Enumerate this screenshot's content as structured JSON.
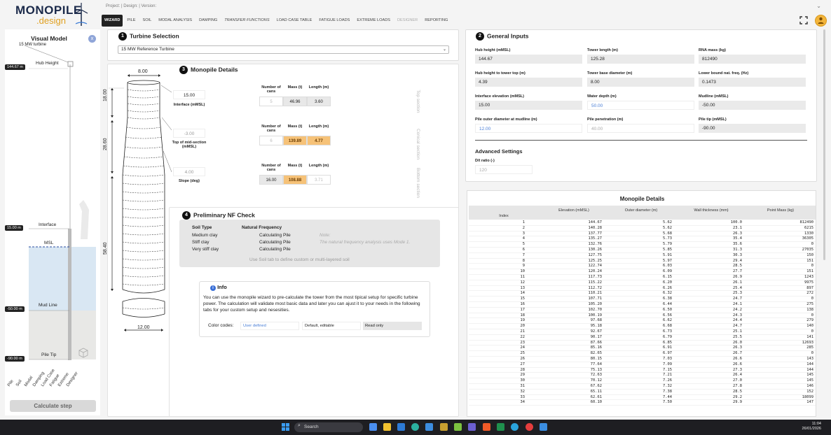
{
  "logo": {
    "line1": "MONOPILE",
    "line2": ".design"
  },
  "topbar": {
    "project_text": "Project: | Design: | Version:"
  },
  "tabs": [
    {
      "label": "WIZARD",
      "state": "active"
    },
    {
      "label": "PILE",
      "state": "normal"
    },
    {
      "label": "SOIL",
      "state": "normal"
    },
    {
      "label": "MODAL ANALYSIS",
      "state": "normal"
    },
    {
      "label": "DAMPING",
      "state": "normal"
    },
    {
      "label": "TRANSFER FUNCTIONS",
      "state": "italic"
    },
    {
      "label": "LOAD CASE TABLE",
      "state": "normal"
    },
    {
      "label": "FATIGUE LOADS",
      "state": "normal"
    },
    {
      "label": "EXTREME LOADS",
      "state": "normal"
    },
    {
      "label": "DESIGNER",
      "state": "disabled"
    },
    {
      "label": "REPORTING",
      "state": "normal"
    }
  ],
  "visual_model": {
    "title": "Visual Model",
    "close": "x",
    "turbine_label": "15 MW turbine",
    "levels": [
      {
        "value": "144.67 m",
        "label": "Hub Height"
      },
      {
        "value": "15.00 m",
        "label": "Interface"
      },
      {
        "value": "",
        "label": "MSL"
      },
      {
        "value": "-50.00 m",
        "label": "Mud Line"
      },
      {
        "value": "-90.00 m",
        "label": "Pile Tip"
      }
    ],
    "steps": [
      "Pile",
      "Soil",
      "Modal",
      "Damping",
      "Load Case",
      "Fatigue",
      "Extreme",
      "Designer"
    ],
    "calculate_label": "Calculate step"
  },
  "turbine_selection": {
    "num": "1",
    "title": "Turbine Selection",
    "selected": "15 MW Reference Turbine"
  },
  "monopile_details": {
    "num": "3",
    "title": "Monopile Details",
    "dims": {
      "top_diameter": "8.00",
      "bottom_diameter": "12.00",
      "h_top": "18.00",
      "h_mid": "28.60",
      "h_bottom": "58.40"
    },
    "interface": {
      "value": "15.00",
      "label": "Interface (mMSL)"
    },
    "top_mid": {
      "value": "-3.00",
      "label": "Top of mid-section (mMSL)"
    },
    "slope": {
      "value": "4.00",
      "label": "Slope (deg)"
    },
    "col_headers": [
      "Number of cans",
      "Mass (t)",
      "Length (m)"
    ],
    "sections": [
      {
        "name": "Top section",
        "cans": "5",
        "mass": "46.96",
        "length": "3.60"
      },
      {
        "name": "Conical section",
        "cans": "6",
        "mass": "139.89",
        "length": "4.77"
      },
      {
        "name": "Bottom section",
        "cans": "16.00",
        "mass": "108.88",
        "length": "3.71"
      }
    ]
  },
  "nf_check": {
    "num": "4",
    "title": "Preliminary NF Check",
    "headers": [
      "Soil Type",
      "Natural Frequency"
    ],
    "rows": [
      {
        "soil": "Medium clay",
        "freq": "Calculating Pile"
      },
      {
        "soil": "Stiff clay",
        "freq": "Calculating Pile"
      },
      {
        "soil": "Very stiff clay",
        "freq": "Calculating Pile"
      }
    ],
    "note_label": "Note:",
    "note_text": "The natural frequency analysis uses Mode 1.",
    "hint": "Use Soil tab to define custom or multi-layered soil"
  },
  "info": {
    "title": "Info",
    "text": "You can use the monopile wizard to pre-calculate the tower from the most tipical setup for specific turbine power. The calculation will validate most basic data and later you can ajust it to your needs in the following tabs for your custom setup and nesesities.",
    "codes_label": "Color codes:",
    "codes": [
      "User defined",
      "Default, editable",
      "Read only"
    ]
  },
  "general_inputs": {
    "num": "2",
    "title": "General Inputs",
    "fields": [
      {
        "label": "Hub height (mMSL)",
        "value": "144.67",
        "style": "normal"
      },
      {
        "label": "Tower length (m)",
        "value": "125.28",
        "style": "normal"
      },
      {
        "label": "RNA mass (kg)",
        "value": "812490",
        "style": "normal"
      },
      {
        "label": "Hub height to tower top (m)",
        "value": "4.39",
        "style": "normal"
      },
      {
        "label": "Tower base diameter (m)",
        "value": "8.00",
        "style": "normal"
      },
      {
        "label": "Lower bound nat. freq. (Hz)",
        "value": "0.1473",
        "style": "normal"
      },
      {
        "label": "Interface elevation (mMSL)",
        "value": "15.00",
        "style": "normal"
      },
      {
        "label": "Water depth (m)",
        "value": "50.00",
        "style": "blue"
      },
      {
        "label": "Mudline (mMSL)",
        "value": "-50.00",
        "style": "normal"
      },
      {
        "label": "Pile outer diameter at mudline (m)",
        "value": "12.00",
        "style": "blue"
      },
      {
        "label": "Pile penetration (m)",
        "value": "40.00",
        "style": "dis"
      },
      {
        "label": "Pile tip (mMSL)",
        "value": "-90.00",
        "style": "normal"
      }
    ],
    "advanced_title": "Advanced Settings",
    "dt_label": "D/t ratio (-)",
    "dt_value": "120"
  },
  "monopile_table": {
    "title": "Monopile Details",
    "headers": [
      "Index",
      "Elevation (mMSL)",
      "Outer diameter (m)",
      "Wall thickness (mm)",
      "Point Mass (kg)"
    ],
    "rows": [
      [
        "1",
        "144.67",
        "5.62",
        "100.0",
        "812490"
      ],
      [
        "2",
        "140.28",
        "5.62",
        "23.1",
        "6215"
      ],
      [
        "3",
        "137.77",
        "5.68",
        "26.3",
        "1330"
      ],
      [
        "4",
        "135.27",
        "5.73",
        "35.4",
        "36305"
      ],
      [
        "5",
        "132.76",
        "5.79",
        "35.6",
        "0"
      ],
      [
        "6",
        "130.26",
        "5.85",
        "31.3",
        "27035"
      ],
      [
        "7",
        "127.75",
        "5.91",
        "30.3",
        "150"
      ],
      [
        "8",
        "125.25",
        "5.97",
        "29.4",
        "151"
      ],
      [
        "9",
        "122.74",
        "6.03",
        "28.5",
        "0"
      ],
      [
        "10",
        "120.24",
        "6.09",
        "27.7",
        "151"
      ],
      [
        "11",
        "117.73",
        "6.15",
        "26.9",
        "1243"
      ],
      [
        "12",
        "115.22",
        "6.20",
        "26.1",
        "9975"
      ],
      [
        "13",
        "112.72",
        "6.26",
        "25.4",
        "897"
      ],
      [
        "14",
        "110.21",
        "6.32",
        "25.3",
        "272"
      ],
      [
        "15",
        "107.71",
        "6.38",
        "24.7",
        "0"
      ],
      [
        "16",
        "105.20",
        "6.44",
        "24.1",
        "275"
      ],
      [
        "17",
        "102.70",
        "6.50",
        "24.2",
        "138"
      ],
      [
        "18",
        "100.19",
        "6.56",
        "24.3",
        "0"
      ],
      [
        "19",
        "97.68",
        "6.62",
        "24.4",
        "279"
      ],
      [
        "20",
        "95.18",
        "6.68",
        "24.7",
        "140"
      ],
      [
        "21",
        "92.67",
        "6.73",
        "25.1",
        "0"
      ],
      [
        "22",
        "90.17",
        "6.79",
        "25.5",
        "141"
      ],
      [
        "23",
        "87.66",
        "6.85",
        "26.0",
        "12693"
      ],
      [
        "24",
        "85.16",
        "6.91",
        "26.3",
        "285"
      ],
      [
        "25",
        "82.65",
        "6.97",
        "26.7",
        "0"
      ],
      [
        "26",
        "80.15",
        "7.03",
        "26.6",
        "143"
      ],
      [
        "27",
        "77.64",
        "7.09",
        "26.6",
        "144"
      ],
      [
        "28",
        "75.13",
        "7.15",
        "27.3",
        "144"
      ],
      [
        "29",
        "72.63",
        "7.21",
        "26.4",
        "145"
      ],
      [
        "30",
        "70.12",
        "7.26",
        "27.0",
        "145"
      ],
      [
        "31",
        "67.62",
        "7.32",
        "27.8",
        "146"
      ],
      [
        "32",
        "65.11",
        "7.38",
        "28.5",
        "152"
      ],
      [
        "33",
        "62.61",
        "7.44",
        "29.2",
        "18099"
      ],
      [
        "34",
        "60.10",
        "7.50",
        "29.9",
        "147"
      ]
    ]
  },
  "taskbar": {
    "search": "Search",
    "time": "11:04",
    "date": "26/01/2026"
  },
  "colors": {
    "accent": "#f3b53b",
    "highlight": "#f6c278",
    "blue_value": "#4a7fd6",
    "dark": "#111111"
  }
}
